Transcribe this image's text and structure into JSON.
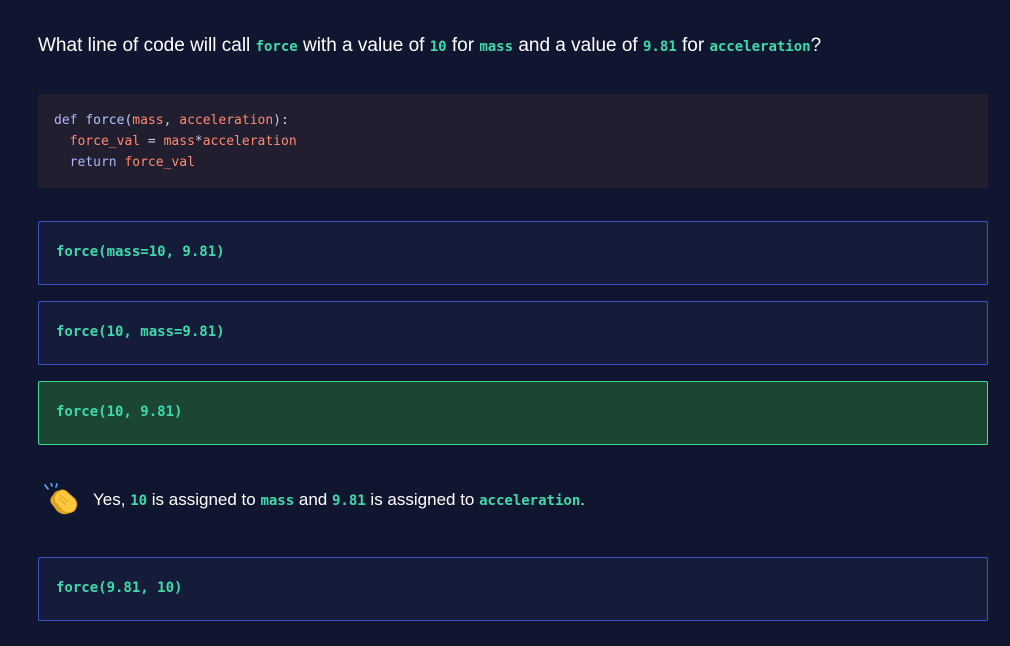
{
  "question": {
    "part1": "What line of code will call ",
    "fn_name": "force",
    "part2": " with a value of ",
    "value1": "10",
    "part3": " for ",
    "param1": "mass",
    "part4": " and a value of ",
    "value2": "9.81",
    "part5": " for ",
    "param2": "acceleration",
    "part6": "?"
  },
  "code": {
    "line1": {
      "kw": "def ",
      "fn": "force",
      "p1": "(",
      "a1": "mass",
      "p2": ", ",
      "a2": "acceleration",
      "p3": "):"
    },
    "line2": {
      "indent": "  ",
      "v1": "force_val",
      "op": " = ",
      "v2": "mass",
      "star": "*",
      "v3": "acceleration"
    },
    "line3": {
      "indent": "  ",
      "kw": "return ",
      "v1": "force_val"
    }
  },
  "options": [
    {
      "label": "force(mass=10, 9.81)",
      "state": "default"
    },
    {
      "label": "force(10, mass=9.81)",
      "state": "default"
    },
    {
      "label": "force(10, 9.81)",
      "state": "correct"
    },
    {
      "label": "force(9.81, 10)",
      "state": "default"
    }
  ],
  "feedback": {
    "icon": "clapping-hands-icon",
    "part1": "Yes, ",
    "value1": "10",
    "part2": " is assigned to ",
    "param1": "mass",
    "part3": " and ",
    "value2": "9.81",
    "part4": " is assigned to ",
    "param2": "acceleration",
    "part5": "."
  },
  "colors": {
    "background": "#10162f",
    "inline_code": "#3ddbab",
    "option_border": "#3a52c5",
    "correct_border": "#3ddb92",
    "correct_background": "#1a4633"
  }
}
